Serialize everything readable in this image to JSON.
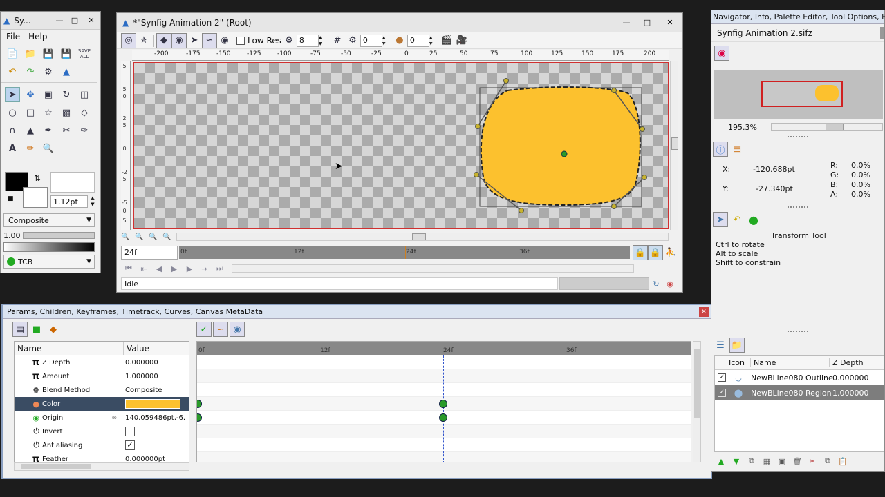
{
  "toolbox": {
    "title": "Sy...",
    "menu": [
      "File",
      "Help"
    ],
    "save_all": "SAVE ALL",
    "width_value": "1.12pt",
    "blend": "Composite",
    "amount": "1.00",
    "interp": "TCB"
  },
  "canvas": {
    "title": "*\"Synfig Animation 2\" (Root)",
    "low_res": "Low Res",
    "res_value": "8",
    "onion_past": "0",
    "onion_future": "0",
    "ruler_h": [
      "-200",
      "-175",
      "-150",
      "-125",
      "-100",
      "-75",
      "-50",
      "-25",
      "0",
      "25",
      "50",
      "75",
      "100",
      "125",
      "150",
      "175",
      "200"
    ],
    "ruler_v": [
      "5",
      "5",
      "0",
      "2",
      "5",
      "0",
      "-2",
      "5",
      "-5",
      "0",
      "5"
    ],
    "time_field": "24f",
    "time_ticks": [
      "0f",
      "12f",
      "24f",
      "36f"
    ],
    "status": "Idle"
  },
  "params_panel": {
    "title": "Params, Children, Keyframes, Timetrack, Curves, Canvas MetaData",
    "col_name": "Name",
    "col_value": "Value",
    "rows": [
      {
        "name": "Z Depth",
        "value": "0.000000"
      },
      {
        "name": "Amount",
        "value": "1.000000"
      },
      {
        "name": "Blend Method",
        "value": "Composite"
      },
      {
        "name": "Color",
        "value": ""
      },
      {
        "name": "Origin",
        "value": "140.059486pt,-6."
      },
      {
        "name": "Invert",
        "value": ""
      },
      {
        "name": "Antialiasing",
        "value": ""
      },
      {
        "name": "Feather",
        "value": "0.000000pt"
      }
    ],
    "time_ticks": [
      "0f",
      "12f",
      "24f",
      "36f"
    ]
  },
  "navigator": {
    "title": "Navigator, Info, Palette Editor, Tool Options, Hist...",
    "file": "Synfig Animation 2.sifz",
    "zoom": "195.3%"
  },
  "info": {
    "x_label": "X:",
    "x_value": "-120.688pt",
    "y_label": "Y:",
    "y_value": "-27.340pt",
    "r_label": "R:",
    "r_value": "0.0%",
    "g_label": "G:",
    "g_value": "0.0%",
    "b_label": "B:",
    "b_value": "0.0%",
    "a_label": "A:",
    "a_value": "0.0%"
  },
  "tool_options": {
    "title": "Transform Tool",
    "hints": [
      "Ctrl to rotate",
      "Alt to scale",
      "Shift to constrain"
    ]
  },
  "layers": {
    "col_icon": "Icon",
    "col_name": "Name",
    "col_z": "Z Depth",
    "rows": [
      {
        "name": "NewBLine080 Outline",
        "z": "0.000000"
      },
      {
        "name": "NewBLine080 Region",
        "z": "1.000000"
      }
    ]
  },
  "colors": {
    "shape_fill": "#fcc12e",
    "selection": "#3a4c63",
    "accent_red": "#d02020"
  }
}
